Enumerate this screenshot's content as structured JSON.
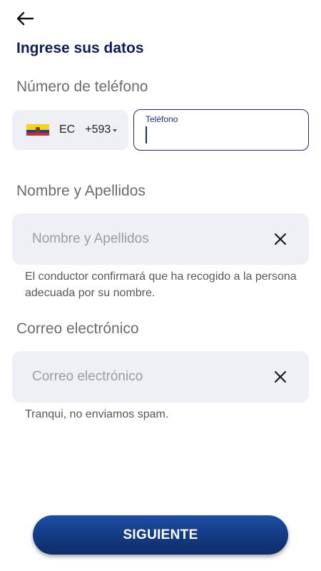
{
  "header": {
    "back_icon": "arrow-left-icon",
    "title": "Ingrese sus datos"
  },
  "phone": {
    "section_label": "Número de teléfono",
    "country_code": "EC",
    "dial_code": "+593",
    "flag_icon": "ecuador-flag-icon",
    "field_label": "Teléfono",
    "value": ""
  },
  "name": {
    "section_label": "Nombre y Apellidos",
    "placeholder": "Nombre y Apellidos",
    "helper": "El conductor confirmará que ha recogido a la persona adecuada por su nombre."
  },
  "email": {
    "section_label": "Correo electrónico",
    "placeholder": "Correo electrónico",
    "helper": "Tranqui, no enviamos spam."
  },
  "footer": {
    "button_label": "SIGUIENTE"
  },
  "colors": {
    "brand": "#0f1d5e",
    "button": "#133a82",
    "field_bg": "#eef0f6"
  }
}
